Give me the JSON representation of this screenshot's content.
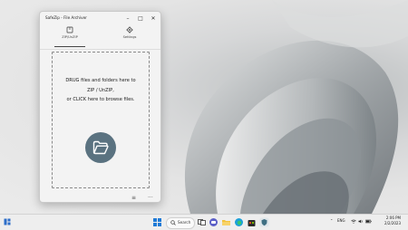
{
  "window": {
    "title": "SafeZip - File Archiver",
    "controls": {
      "minimize": "–",
      "maximize": "□",
      "close": "✕"
    }
  },
  "tabs": [
    {
      "label": "ZIP/UnZIP",
      "icon": "archive-icon",
      "selected": true
    },
    {
      "label": "Settings",
      "icon": "gear-icon",
      "selected": false
    }
  ],
  "dropzone": {
    "line1": "DRUG files and folders here to",
    "line2": "ZIP / UnZIP,",
    "line3": "or CLICK here to browse files.",
    "icon": "open-folder-icon"
  },
  "footer": {
    "list_icon": "≡",
    "more_icon": "···"
  },
  "taskbar": {
    "search_label": "Search",
    "tray_lang": "ENG",
    "time": "2:06 PM",
    "date": "2/2/2023"
  },
  "colors": {
    "folder_circle": "#5a7280",
    "window_bg": "#f3f3f3",
    "taskbar_bg": "#eeeeee"
  }
}
